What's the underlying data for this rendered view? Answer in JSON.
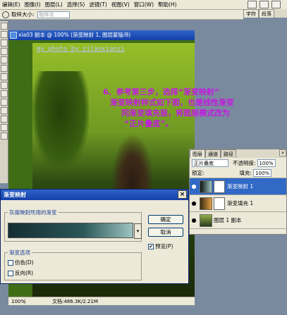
{
  "menubar": {
    "items": [
      "编辑(E)",
      "图像(I)",
      "图层(L)",
      "选择(S)",
      "滤镜(T)",
      "视图(V)",
      "窗口(W)",
      "帮助(H)"
    ]
  },
  "palette_tabs": [
    "字符",
    "段落"
  ],
  "options_bar": {
    "sample_size_label": "取样大小:",
    "sample_size_value": "取样点"
  },
  "document": {
    "title": "xia03 副本 @ 100% (渐变映射 1, 图层蒙版/8)",
    "watermark": "my photo by zilanxianzi",
    "zoom": "100%",
    "doc_size": "文档:486.3K/2.21M"
  },
  "annotation": {
    "lines": [
      "6、参考第三步，选择“渐变映射”",
      "渐变映射样式如下图，也是线性渐变",
      "同渐变填充层，将图层模式改为",
      "“正片叠底”。"
    ]
  },
  "dialog": {
    "title": "渐变映射",
    "gradient_group_label": "灰度映射所用的渐变",
    "options_group_label": "渐变选项",
    "dither_label": "仿色(D)",
    "reverse_label": "反向(R)",
    "ok_label": "确定",
    "cancel_label": "取消",
    "preview_label": "预览(P)",
    "preview_checked": "✔",
    "colors": {
      "gradient_start": "#152d33",
      "gradient_mid": "#2a5758",
      "gradient_end": "#9ec4c0"
    }
  },
  "layers_panel": {
    "tabs": [
      "图层",
      "通道",
      "路径"
    ],
    "blend_mode": "正片叠底",
    "opacity_label": "不透明度:",
    "opacity_value": "100%",
    "lock_label": "锁定:",
    "fill_label": "填充:",
    "fill_value": "100%",
    "layers": [
      {
        "name": "渐变映射 1",
        "selected": true
      },
      {
        "name": "渐变填充 1",
        "selected": false
      },
      {
        "name": "图层 1 副本",
        "selected": false
      }
    ]
  }
}
